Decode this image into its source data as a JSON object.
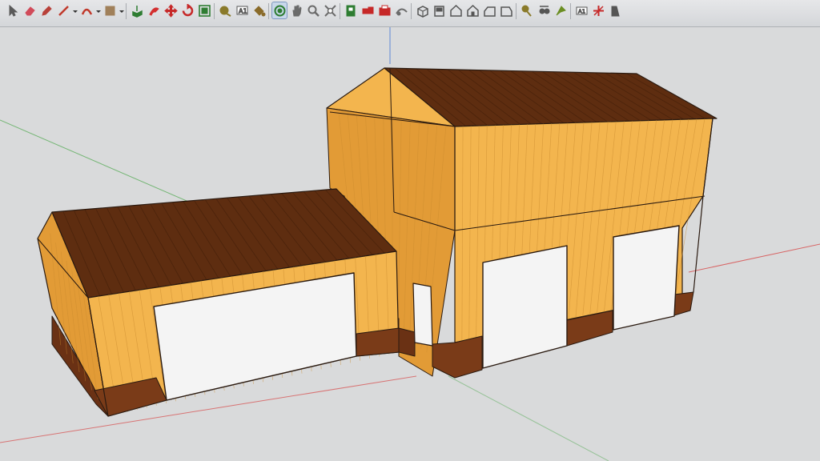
{
  "app": {
    "toolbar": {
      "tools": [
        {
          "icon": "select-arrow-icon",
          "color": "#5a5a5a",
          "has_menu": false
        },
        {
          "icon": "eraser-icon",
          "color": "#d14b5a",
          "has_menu": false
        },
        {
          "icon": "pencil-icon",
          "color": "#b8413a",
          "has_menu": false
        },
        {
          "icon": "line-tool-icon",
          "color": "#c0392b",
          "has_menu": true
        },
        {
          "icon": "arc-tool-icon",
          "color": "#c0392b",
          "has_menu": true
        },
        {
          "icon": "shapes-tool-icon",
          "color": "#a0805a",
          "has_menu": true
        },
        {
          "icon": "push-pull-icon",
          "color": "#2e7d32",
          "has_menu": false
        },
        {
          "icon": "follow-me-icon",
          "color": "#d32f2f",
          "has_menu": false
        },
        {
          "icon": "move-icon",
          "color": "#c62828",
          "has_menu": false
        },
        {
          "icon": "rotate-icon",
          "color": "#c62828",
          "has_menu": false
        },
        {
          "icon": "scale-icon",
          "color": "#2e7d32",
          "has_menu": false
        },
        {
          "icon": "tape-measure-icon",
          "color": "#8a7a2a",
          "has_menu": false
        },
        {
          "icon": "text-tool-icon",
          "color": "#555555",
          "has_menu": false
        },
        {
          "icon": "paint-bucket-icon",
          "color": "#8a6b2a",
          "has_menu": false
        },
        {
          "icon": "orbit-icon",
          "color": "#2e7d32",
          "has_menu": false,
          "active": true
        },
        {
          "icon": "pan-hand-icon",
          "color": "#6b6b6b",
          "has_menu": false
        },
        {
          "icon": "zoom-icon",
          "color": "#6b6b6b",
          "has_menu": false
        },
        {
          "icon": "zoom-extents-icon",
          "color": "#6b6b6b",
          "has_menu": false
        },
        {
          "icon": "component-icon",
          "color": "#2e7d32",
          "has_menu": false
        },
        {
          "icon": "warehouse-icon",
          "color": "#c62828",
          "has_menu": false
        },
        {
          "icon": "extension-warehouse-icon",
          "color": "#c62828",
          "has_menu": false
        },
        {
          "icon": "share-model-icon",
          "color": "#6b6b6b",
          "has_menu": false
        },
        {
          "icon": "iso-view-icon",
          "color": "#555555",
          "has_menu": false
        },
        {
          "icon": "top-view-icon",
          "color": "#555555",
          "has_menu": false
        },
        {
          "icon": "front-view-icon",
          "color": "#555555",
          "has_menu": false
        },
        {
          "icon": "right-view-icon",
          "color": "#555555",
          "has_menu": false
        },
        {
          "icon": "back-view-icon",
          "color": "#555555",
          "has_menu": false
        },
        {
          "icon": "left-view-icon",
          "color": "#555555",
          "has_menu": false
        },
        {
          "icon": "position-camera-icon",
          "color": "#8a7a2a",
          "has_menu": false
        },
        {
          "icon": "look-around-icon",
          "color": "#555555",
          "has_menu": false
        },
        {
          "icon": "walk-icon",
          "color": "#6b8e23",
          "has_menu": false
        },
        {
          "icon": "dimension-icon",
          "color": "#555555",
          "has_menu": false
        },
        {
          "icon": "axes-icon",
          "color": "#c62828",
          "has_menu": false
        },
        {
          "icon": "section-plane-icon",
          "color": "#555555",
          "has_menu": false
        }
      ]
    },
    "viewport": {
      "background_color": "#d9dadb",
      "colors": {
        "wall_light": "#f3b54e",
        "wall_shade": "#e29b36",
        "wainscot": "#7a3b18",
        "wainscot_shade": "#6a3114",
        "roof": "#5e2d10",
        "roof_rib": "#3f1d08",
        "door": "#f4f4f4",
        "edge": "#2a1a10",
        "axis_red": "#d85a5a",
        "axis_green": "#6cb36c",
        "axis_blue": "#6b8fd6"
      }
    }
  }
}
